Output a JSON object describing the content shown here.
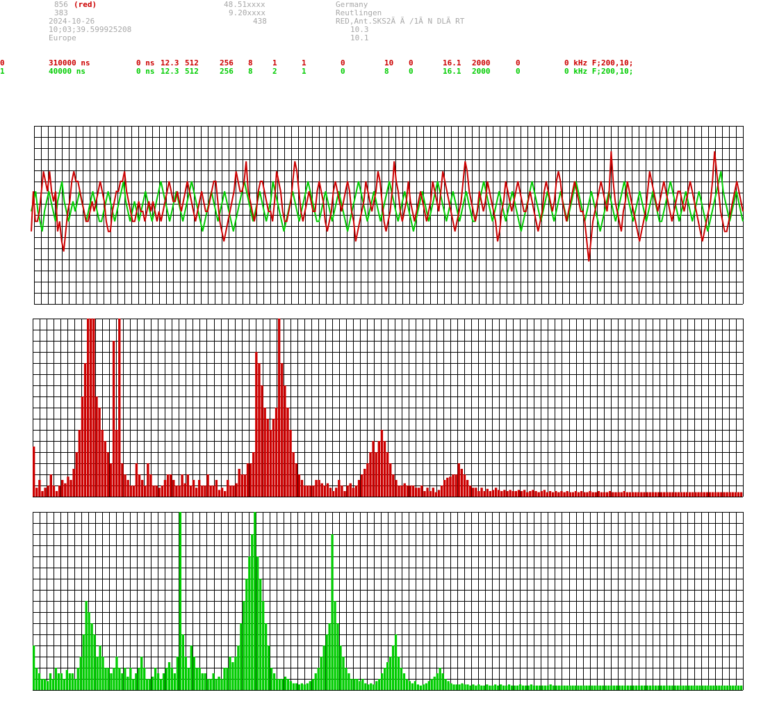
{
  "header": {
    "station_id": "856",
    "station_color": "(red)",
    "num2": "383",
    "date": "2024-10-26",
    "time": "10;03;39.599925208",
    "region": "Europe",
    "lat": "48.51xxxx",
    "lon": "9.20xxxx",
    "alt": "438",
    "country": "Germany",
    "city": "Reutlingen",
    "antenna": "RED,Ant.SKS2Ã Ã /1Ã N DLÃ RT",
    "val1": "10.3",
    "val2": "10.1"
  },
  "channels": [
    {
      "ch": "0",
      "period": "310000 ns",
      "delay": "0 ns",
      "f": "12.3",
      "n": "512",
      "a": "256",
      "b": "8",
      "c": "1",
      "d": "1",
      "e": "0",
      "g": "10",
      "h": "0",
      "i": "16.1",
      "j": "2000",
      "k": "0",
      "filter": "0 kHz F;200,10;",
      "color": "#cc0000"
    },
    {
      "ch": "1",
      "period": "40000 ns",
      "delay": "0 ns",
      "f": "12.3",
      "n": "512",
      "a": "256",
      "b": "8",
      "c": "2",
      "d": "1",
      "e": "0",
      "g": "8",
      "h": "0",
      "i": "16.1",
      "j": "2000",
      "k": "0",
      "filter": "0 kHz F;200,10;",
      "color": "#00cc00"
    }
  ],
  "colors": {
    "red": "#cc0000",
    "green": "#00cc00",
    "grid": "#000000",
    "header": "#a8a8a8"
  },
  "chart_data": [
    {
      "type": "line",
      "title": "",
      "ylim": [
        -8,
        8
      ],
      "grid": true,
      "markers": [
        {
          "series": "green",
          "x": 534
        },
        {
          "series": "red",
          "x": 796
        }
      ],
      "series": [
        {
          "color": "#cc0000",
          "values": [
            -2,
            2,
            -1,
            -1,
            0,
            2,
            4,
            3,
            2,
            4,
            2,
            1,
            2,
            -2,
            -1,
            -3,
            -4,
            -2,
            0,
            1,
            3,
            4,
            3,
            3,
            2,
            1,
            0,
            -1,
            -1,
            0,
            1,
            0,
            1,
            2,
            3,
            2,
            1,
            -1,
            -2,
            -2,
            0,
            1,
            2,
            2,
            3,
            3,
            4,
            2,
            1,
            0,
            -1,
            -1,
            0,
            1,
            0,
            0,
            -1,
            0,
            1,
            0,
            1,
            0,
            -1,
            0,
            -1,
            0,
            1,
            2,
            3,
            2,
            1,
            1,
            2,
            1,
            0,
            1,
            2,
            3,
            2,
            1,
            0,
            -1,
            0,
            1,
            2,
            1,
            0,
            0,
            1,
            2,
            3,
            3,
            1,
            -1,
            -2,
            -3,
            -2,
            -1,
            0,
            1,
            2,
            4,
            3,
            2,
            2,
            3,
            5,
            2,
            1,
            0,
            -1,
            0,
            2,
            3,
            3,
            2,
            1,
            0,
            0,
            -1,
            1,
            4,
            3,
            2,
            0,
            -1,
            -1,
            0,
            1,
            3,
            5,
            4,
            2,
            0,
            -1,
            0,
            1,
            2,
            1,
            0,
            0,
            2,
            3,
            2,
            1,
            -1,
            -2,
            -1,
            0,
            2,
            3,
            2,
            1,
            0,
            1,
            2,
            3,
            2,
            0,
            -1,
            -3,
            -2,
            -1,
            0,
            1,
            3,
            2,
            1,
            0,
            1,
            2,
            4,
            3,
            1,
            -1,
            -2,
            -1,
            0,
            2,
            5,
            3,
            2,
            0,
            -1,
            0,
            1,
            3,
            1,
            0,
            -1,
            0,
            1,
            2,
            1,
            0,
            -1,
            0,
            1,
            3,
            2,
            1,
            0,
            2,
            4,
            3,
            2,
            1,
            0,
            -1,
            -2,
            -1,
            0,
            1,
            3,
            5,
            4,
            2,
            1,
            0,
            -1,
            0,
            2,
            1,
            0,
            1,
            3,
            2,
            1,
            0,
            -1,
            -3,
            -2,
            0,
            1,
            3,
            2,
            1,
            0,
            1,
            2,
            3,
            2,
            1,
            0,
            0,
            1,
            2,
            1,
            0,
            -1,
            -2,
            -1,
            0,
            2,
            3,
            2,
            1,
            0,
            1,
            3,
            4,
            3,
            1,
            0,
            -1,
            0,
            1,
            2,
            3,
            2,
            1,
            0,
            0,
            -1,
            -3,
            -5,
            -3,
            -1,
            0,
            1,
            2,
            3,
            2,
            1,
            0,
            2,
            6,
            3,
            1,
            0,
            -1,
            -2,
            0,
            1,
            3,
            2,
            1,
            0,
            -1,
            -2,
            -3,
            -2,
            -1,
            0,
            2,
            4,
            3,
            2,
            1,
            0,
            1,
            2,
            3,
            2,
            1,
            0,
            -1,
            0,
            1,
            2,
            2,
            1,
            0,
            1,
            2,
            3,
            2,
            1,
            0,
            -1,
            -2,
            -3,
            -2,
            -1,
            0,
            1,
            3,
            6,
            4,
            2,
            0,
            -1,
            -2,
            -2,
            -1,
            0,
            1,
            2,
            3,
            2,
            1,
            0
          ]
        },
        {
          "color": "#00cc00",
          "values": [
            0,
            1,
            2,
            0,
            -1,
            -2,
            0,
            1,
            2,
            1,
            0,
            -1,
            1,
            2,
            3,
            1,
            0,
            -1,
            0,
            1,
            0,
            1,
            2,
            1,
            0,
            -1,
            0,
            1,
            2,
            1,
            0,
            -1,
            -1,
            0,
            1,
            2,
            1,
            0,
            -1,
            0,
            1,
            2,
            3,
            1,
            0,
            -1,
            0,
            1,
            0,
            -1,
            0,
            1,
            2,
            1,
            0,
            -1,
            0,
            1,
            2,
            3,
            2,
            1,
            0,
            -1,
            0,
            1,
            2,
            1,
            0,
            -1,
            0,
            1,
            2,
            3,
            2,
            1,
            0,
            -1,
            -2,
            -1,
            0,
            1,
            2,
            1,
            0,
            -1,
            0,
            1,
            2,
            1,
            0,
            -1,
            -2,
            -1,
            0,
            1,
            2,
            3,
            2,
            1,
            0,
            -1,
            0,
            1,
            2,
            1,
            0,
            -1,
            0,
            1,
            3,
            2,
            1,
            0,
            -1,
            -2,
            -1,
            0,
            1,
            2,
            1,
            0,
            -1,
            0,
            1,
            2,
            3,
            2,
            1,
            0,
            -1,
            -1,
            0,
            1,
            2,
            1,
            0,
            -1,
            0,
            1,
            2,
            1,
            0,
            -1,
            -2,
            -1,
            0,
            1,
            2,
            3,
            2,
            1,
            0,
            -1,
            0,
            1,
            2,
            1,
            0,
            -1,
            0,
            1,
            2,
            3,
            2,
            1,
            0,
            -1,
            0,
            1,
            2,
            1,
            0,
            -1,
            -2,
            -1,
            0,
            1,
            2,
            1,
            0,
            -1,
            0,
            1,
            2,
            3,
            2,
            1,
            0,
            -1,
            0,
            1,
            2,
            1,
            0,
            -1,
            0,
            1,
            2,
            1,
            0,
            -1,
            -1,
            0,
            1,
            2,
            3,
            2,
            1,
            0,
            -1,
            0,
            1,
            2,
            1,
            0,
            -1,
            0,
            1,
            2,
            1,
            0,
            -1,
            -2,
            -1,
            0,
            1,
            2,
            3,
            2,
            1,
            0,
            -1,
            0,
            1,
            2,
            1,
            0,
            -1,
            0,
            1,
            2,
            1,
            0,
            -1,
            0,
            1,
            2,
            3,
            2,
            1,
            0,
            -1,
            0,
            1,
            2,
            1,
            0,
            -1,
            -2,
            -1,
            0,
            1,
            2,
            1,
            0,
            -1,
            0,
            1,
            2,
            3,
            2,
            1,
            0,
            -1,
            0,
            1,
            2,
            1,
            0,
            -1,
            0,
            1,
            2,
            1,
            0,
            -1,
            -1,
            0,
            1,
            2,
            3,
            2,
            1,
            0,
            -1,
            0,
            1,
            2,
            1,
            0,
            -1,
            0,
            1,
            2,
            1,
            0,
            -1,
            -2,
            -1,
            0,
            1,
            2,
            3,
            4,
            2,
            1,
            0,
            -1,
            0,
            1,
            2,
            1,
            0,
            -1
          ]
        }
      ]
    },
    {
      "type": "bar",
      "color": "#cc0000",
      "ylim": [
        0,
        16
      ],
      "grid": true,
      "values": [
        4.5,
        0.8,
        1.5,
        0.5,
        0.8,
        1,
        2,
        1,
        0.5,
        1,
        1.5,
        1.2,
        1.8,
        1.5,
        2.5,
        4,
        6,
        9,
        12,
        16,
        16,
        16,
        9,
        8,
        6,
        5,
        4,
        3,
        14,
        6,
        16,
        3,
        2,
        1.5,
        1,
        1,
        3,
        2,
        1.5,
        1,
        3,
        2,
        1,
        1,
        0.8,
        1,
        1.5,
        2,
        2,
        1.5,
        1,
        1,
        2,
        1.2,
        2,
        1,
        1.5,
        0.8,
        1.5,
        1,
        1,
        2,
        1,
        1,
        1.5,
        0.6,
        0.8,
        0.5,
        1.5,
        1,
        1,
        1.2,
        2.5,
        2,
        2,
        3,
        3,
        4,
        13,
        12,
        10,
        8,
        7,
        6,
        7,
        8,
        16,
        12,
        10,
        8,
        6,
        4,
        3,
        2,
        1.5,
        1,
        1,
        1,
        1,
        1.5,
        1.5,
        1.2,
        1,
        1.2,
        0.8,
        0.5,
        0.8,
        1.5,
        1,
        0.5,
        1,
        1.2,
        0.8,
        1,
        1.5,
        2,
        2.5,
        3,
        4,
        5,
        4,
        5,
        6,
        5,
        4,
        3,
        2,
        1.5,
        1,
        1,
        1.2,
        1,
        1,
        1,
        0.8,
        0.8,
        1,
        0.5,
        0.8,
        0.5,
        0.8,
        0.4,
        0.6,
        1,
        1.5,
        1.7,
        1.8,
        2,
        2,
        3,
        2.5,
        2,
        1.5,
        1,
        0.8,
        0.8,
        0.5,
        0.8,
        0.5,
        0.7,
        0.5,
        0.6,
        0.8,
        0.6,
        0.5,
        0.6,
        0.5,
        0.6,
        0.5,
        0.5,
        0.6,
        0.5,
        0.6,
        0.4,
        0.5,
        0.6,
        0.5,
        0.4,
        0.5,
        0.6,
        0.4,
        0.5,
        0.4,
        0.5,
        0.4,
        0.5,
        0.4,
        0.5,
        0.4,
        0.4,
        0.5,
        0.4,
        0.5,
        0.4,
        0.4,
        0.5,
        0.4,
        0.4,
        0.5,
        0.4,
        0.4,
        0.4,
        0.5,
        0.4,
        0.4,
        0.4,
        0.4,
        0.5,
        0.4,
        0.4,
        0.4,
        0.4,
        0.4,
        0.4,
        0.4,
        0.4,
        0.4,
        0.4,
        0.4,
        0.4,
        0.4,
        0.4,
        0.4,
        0.4,
        0.4,
        0.4,
        0.4,
        0.4,
        0.4,
        0.4,
        0.4,
        0.4,
        0.4,
        0.4,
        0.4,
        0.4,
        0.4,
        0.4,
        0.4,
        0.4,
        0.4,
        0.4,
        0.4,
        0.4,
        0.4,
        0.4,
        0.4,
        0.4,
        0.4
      ]
    },
    {
      "type": "bar",
      "color": "#00cc00",
      "ylim": [
        0,
        16
      ],
      "grid": true,
      "values": [
        4,
        2,
        1.5,
        1,
        1,
        0.8,
        1.5,
        1,
        2,
        1.5,
        1.5,
        1,
        1.8,
        1.5,
        1.5,
        1,
        2,
        3,
        5,
        8,
        7,
        6,
        5,
        3,
        4,
        3,
        2,
        2,
        1.5,
        2,
        3,
        2,
        1.5,
        2,
        1.2,
        2,
        1,
        1.5,
        2,
        3,
        2,
        1,
        1,
        1.2,
        2,
        1.5,
        1,
        1.5,
        2,
        2.5,
        2,
        1.5,
        3,
        16,
        5,
        3,
        2,
        4,
        3,
        2,
        2,
        1.5,
        1.5,
        1,
        1,
        1.5,
        1,
        1.2,
        1,
        2,
        2,
        3,
        2.5,
        3,
        4,
        6,
        8,
        10,
        12,
        14,
        16,
        12,
        10,
        8,
        6,
        4,
        2,
        1.5,
        1,
        1,
        1,
        1.2,
        1,
        0.8,
        0.6,
        0.6,
        0.5,
        0.6,
        0.5,
        0.6,
        0.8,
        1,
        1.5,
        2,
        3,
        4,
        5,
        6,
        14,
        8,
        6,
        4,
        3,
        2,
        1.5,
        1,
        1,
        1,
        0.8,
        1,
        0.6,
        0.5,
        0.6,
        0.5,
        0.8,
        1,
        1.5,
        2,
        2.5,
        3,
        4,
        5,
        3,
        2,
        1.5,
        1,
        0.8,
        0.6,
        0.8,
        0.5,
        0.4,
        0.5,
        0.6,
        0.8,
        1,
        1.2,
        1.5,
        2,
        1.5,
        1,
        0.8,
        0.6,
        0.5,
        0.5,
        0.5,
        0.6,
        0.5,
        0.5,
        0.4,
        0.5,
        0.4,
        0.5,
        0.4,
        0.4,
        0.5,
        0.4,
        0.4,
        0.5,
        0.4,
        0.5,
        0.4,
        0.4,
        0.5,
        0.4,
        0.4,
        0.4,
        0.5,
        0.4,
        0.4,
        0.4,
        0.5,
        0.4,
        0.4,
        0.4,
        0.4,
        0.4,
        0.4,
        0.5,
        0.4,
        0.4,
        0.4,
        0.4,
        0.4,
        0.4,
        0.4,
        0.4,
        0.4,
        0.4,
        0.4,
        0.4,
        0.4,
        0.4,
        0.4,
        0.4,
        0.4,
        0.4,
        0.4,
        0.4,
        0.4,
        0.4,
        0.4,
        0.4,
        0.4,
        0.4,
        0.4,
        0.4,
        0.4,
        0.4,
        0.4,
        0.4,
        0.4,
        0.4,
        0.4,
        0.4,
        0.4,
        0.4,
        0.4,
        0.4,
        0.4,
        0.4,
        0.4,
        0.4,
        0.4,
        0.4,
        0.4,
        0.4,
        0.4,
        0.4,
        0.4,
        0.4,
        0.4,
        0.4,
        0.4,
        0.4,
        0.4,
        0.4,
        0.4,
        0.4,
        0.4,
        0.4,
        0.4,
        0.4,
        0.4,
        0.4,
        0.4,
        0.4,
        0.4
      ]
    }
  ]
}
